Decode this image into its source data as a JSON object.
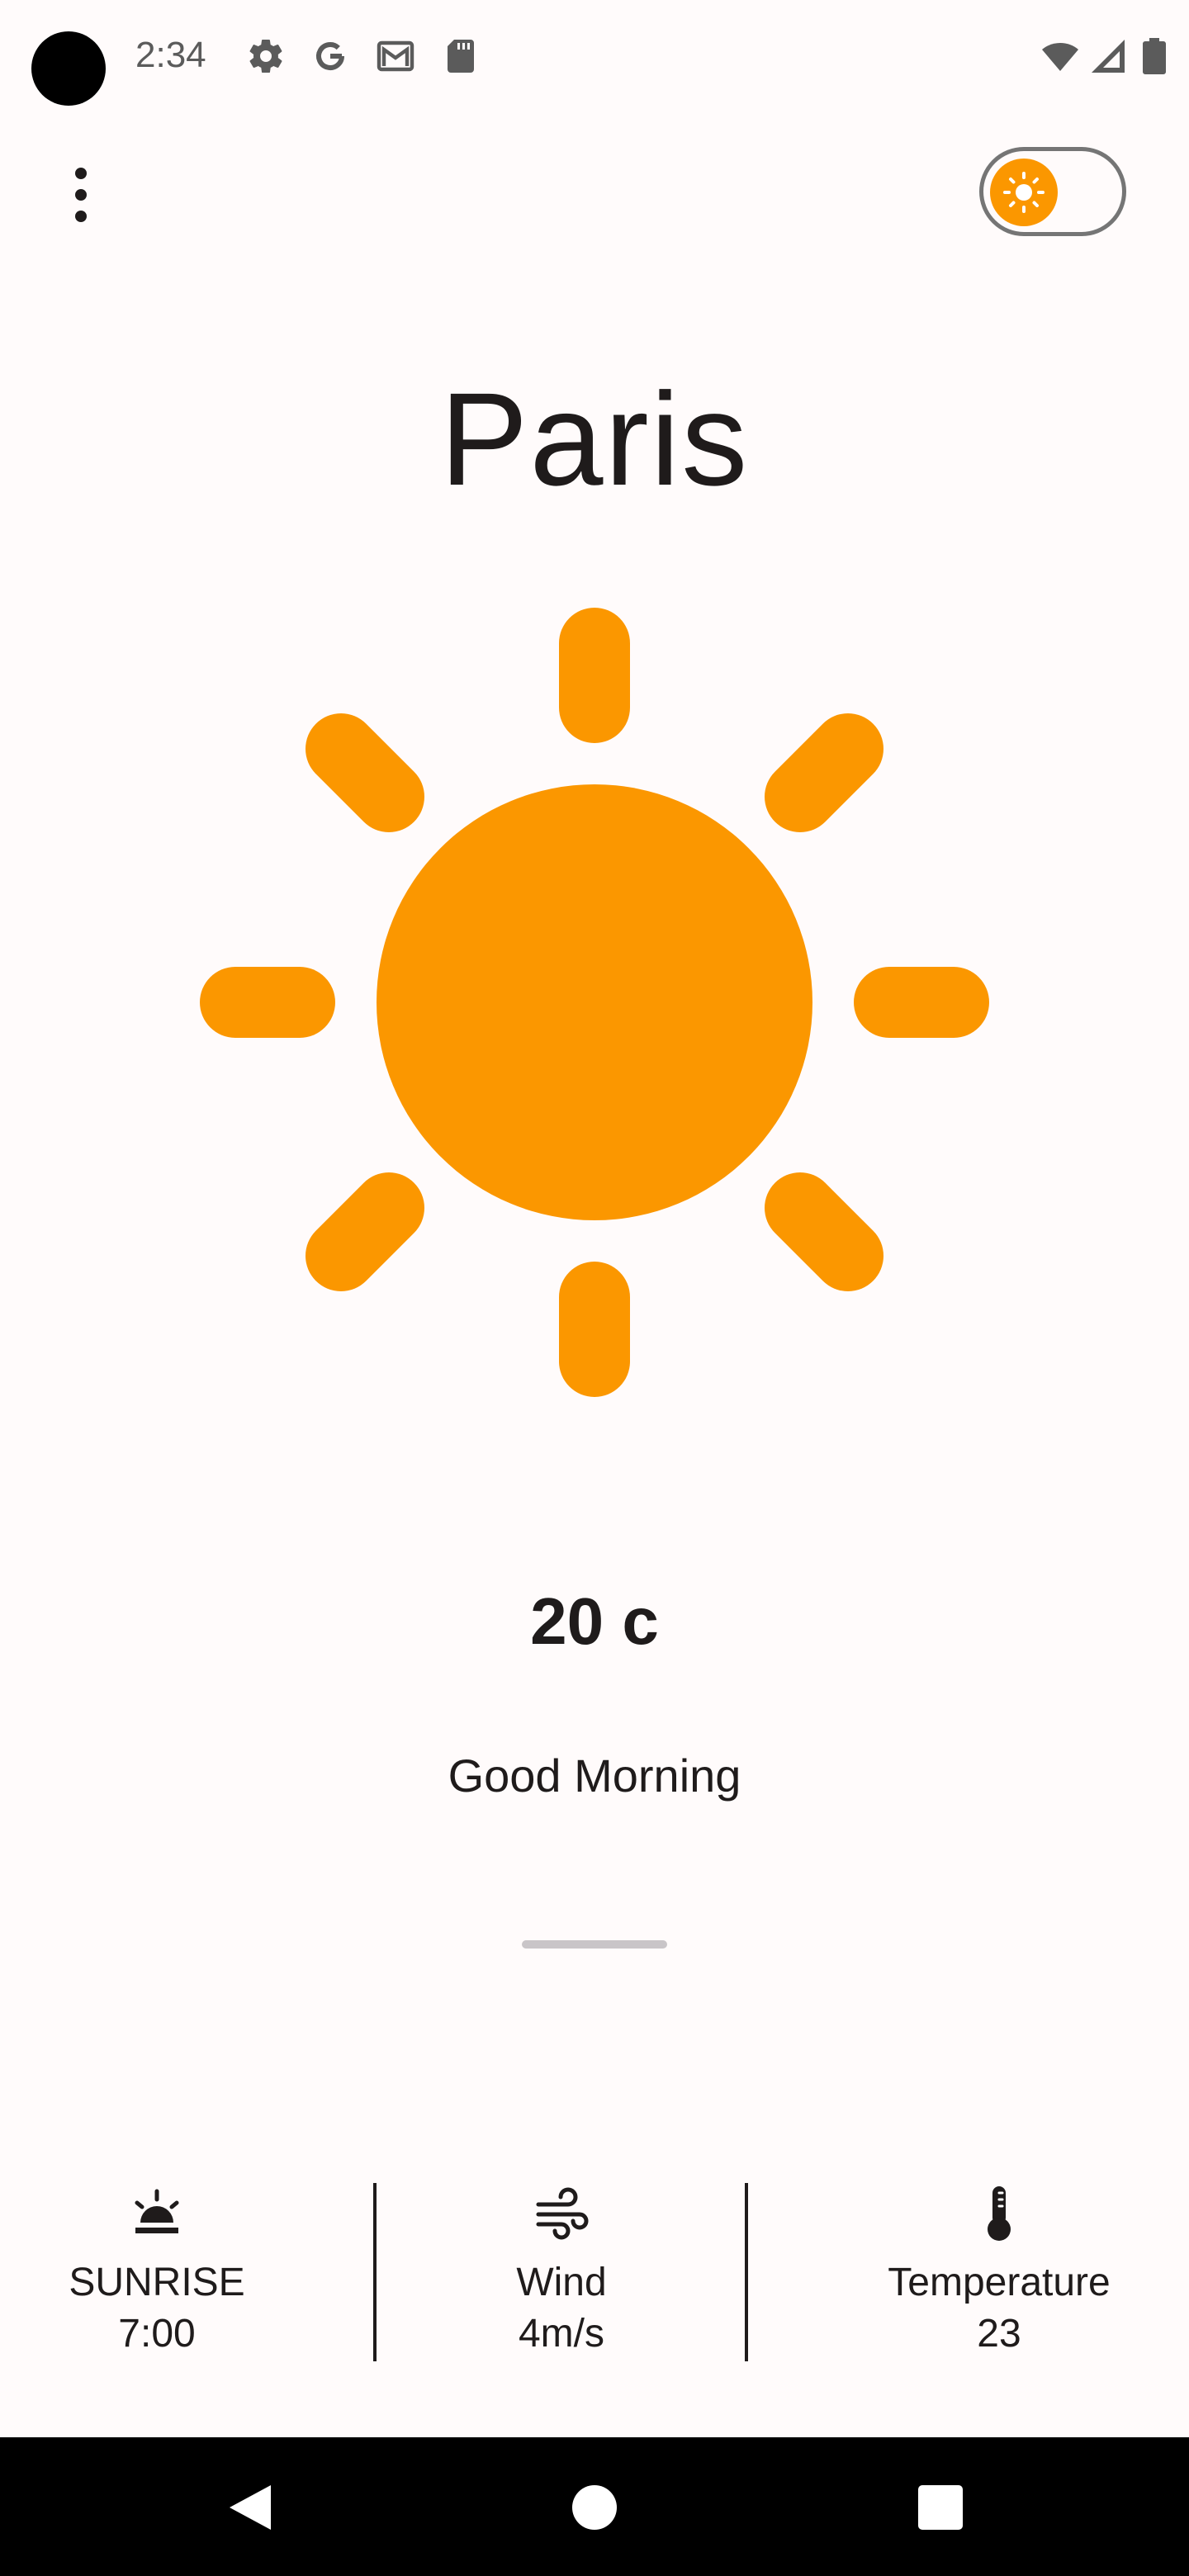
{
  "status_bar": {
    "time": "2:34",
    "icons": [
      "gear-icon",
      "google-icon",
      "gmail-icon",
      "sd-card-icon",
      "wifi-icon",
      "signal-icon",
      "battery-icon"
    ]
  },
  "app_bar": {
    "menu_icon": "more-vertical-icon",
    "theme_toggle_icon": "sun-icon",
    "theme_mode": "light"
  },
  "weather": {
    "city": "Paris",
    "condition_icon": "sun-icon",
    "temperature": "20 c",
    "greeting": "Good Morning"
  },
  "info": [
    {
      "icon": "sunrise-icon",
      "label": "SUNRISE",
      "value": "7:00"
    },
    {
      "icon": "wind-icon",
      "label": "Wind",
      "value": "4m/s"
    },
    {
      "icon": "thermometer-icon",
      "label": "Temperature",
      "value": "23"
    }
  ],
  "colors": {
    "accent": "#FB9700",
    "background": "#FFFBFB",
    "text": "#1F1B1B"
  }
}
